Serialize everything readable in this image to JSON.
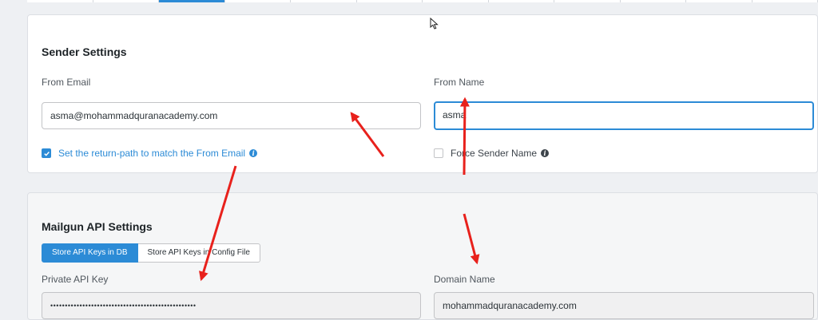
{
  "sender_settings": {
    "title": "Sender Settings",
    "from_email": {
      "label": "From Email",
      "value": "asma@mohammadquranacademy.com"
    },
    "from_name": {
      "label": "From Name",
      "value": "asma"
    },
    "return_path": {
      "label": "Set the return-path to match the From Email",
      "checked": true
    },
    "force_sender_name": {
      "label": "Force Sender Name",
      "checked": false
    }
  },
  "mailgun_api_settings": {
    "title": "Mailgun API Settings",
    "toggle": {
      "db_label": "Store API Keys in DB",
      "config_label": "Store API Keys in Config File",
      "selected": "db"
    },
    "private_api_key": {
      "label": "Private API Key",
      "value": "••••••••••••••••••••••••••••••••••••••••••••••••••"
    },
    "domain_name": {
      "label": "Domain Name",
      "value": "mohammadquranacademy.com"
    }
  },
  "colors": {
    "accent": "#2c8bd6",
    "annotation_arrow": "#e8211c"
  }
}
